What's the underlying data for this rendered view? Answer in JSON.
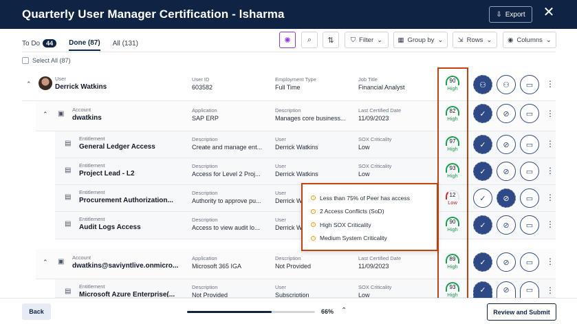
{
  "header": {
    "title": "Quarterly User Manager Certification - lsharma",
    "export_label": "Export",
    "close_icon": "close-icon"
  },
  "tabs": [
    {
      "label": "To Do",
      "badge": "44"
    },
    {
      "label": "Done (87)"
    },
    {
      "label": "All (131)"
    }
  ],
  "toolbar": {
    "filter_label": "Filter",
    "group_label": "Group by",
    "rows_label": "Rows",
    "columns_label": "Columns"
  },
  "select_all_label": "Select All (87)",
  "rows": [
    {
      "type_label": "User",
      "name": "Derrick Watkins",
      "c1_label": "User ID",
      "c1_val": "603582",
      "c2_label": "Employment Type",
      "c2_val": "Full Time",
      "c3_label": "Job Title",
      "c3_val": "Financial Analyst",
      "risk": "90",
      "risk_level": "High"
    },
    {
      "type_label": "Account",
      "name": "dwatkins",
      "c1_label": "Application",
      "c1_val": "SAP ERP",
      "c2_label": "Description",
      "c2_val": "Manages core business...",
      "c3_label": "Last Certified Date",
      "c3_val": "11/09/2023",
      "risk": "82",
      "risk_level": "High"
    },
    {
      "type_label": "Entitlement",
      "name": "General Ledger Access",
      "c1_label": "Description",
      "c1_val": "Create and manage ent...",
      "c2_label": "User",
      "c2_val": "Derrick Watkins",
      "c3_label": "SOX Criticality",
      "c3_val": "Low",
      "risk": "97",
      "risk_level": "High"
    },
    {
      "type_label": "Entitlement",
      "name": "Project Lead - L2",
      "c1_label": "Description",
      "c1_val": "Access for Level 2 Proj...",
      "c2_label": "User",
      "c2_val": "Derrick Watkins",
      "c3_label": "SOX Criticality",
      "c3_val": "Low",
      "risk": "93",
      "risk_level": "High"
    },
    {
      "type_label": "Entitlement",
      "name": "Procurement Authorization...",
      "c1_label": "Description",
      "c1_val": "Authority to approve pu...",
      "c2_label": "User",
      "c2_val": "Derrick Wa",
      "c3_label": "",
      "c3_val": "",
      "risk": "12",
      "risk_level": "Low"
    },
    {
      "type_label": "Entitlement",
      "name": "Audit Logs Access",
      "c1_label": "Description",
      "c1_val": "Access to view audit lo...",
      "c2_label": "User",
      "c2_val": "Derrick Wa",
      "c3_label": "",
      "c3_val": "",
      "risk": "90",
      "risk_level": "High"
    },
    {
      "type_label": "Account",
      "name": "dwatkins@saviyntlive.onmicro...",
      "c1_label": "Application",
      "c1_val": "Microsoft 365 IGA",
      "c2_label": "Description",
      "c2_val": "Not Provided",
      "c3_label": "Last Certified Date",
      "c3_val": "11/09/2023",
      "risk": "89",
      "risk_level": "High"
    },
    {
      "type_label": "Entitlement",
      "name": "Microsoft Azure Enterprise(...",
      "c1_label": "Description",
      "c1_val": "Not Provided",
      "c2_label": "User",
      "c2_val": "Subscription",
      "c3_label": "SOX Criticality",
      "c3_val": "Low",
      "risk": "93",
      "risk_level": "High"
    }
  ],
  "tooltip": {
    "items": [
      "Less than 75% of Peer has access",
      "2 Access Conflicts (SoD)",
      "High SOX Criticality",
      "Medium System Criticality"
    ]
  },
  "footer": {
    "back_label": "Back",
    "progress_text": "66%",
    "progress_value": 0.66,
    "submit_label": "Review and Submit"
  },
  "colors": {
    "header_bg": "#0f2444",
    "accent": "#2e4a86",
    "highlight": "#c2410c"
  }
}
